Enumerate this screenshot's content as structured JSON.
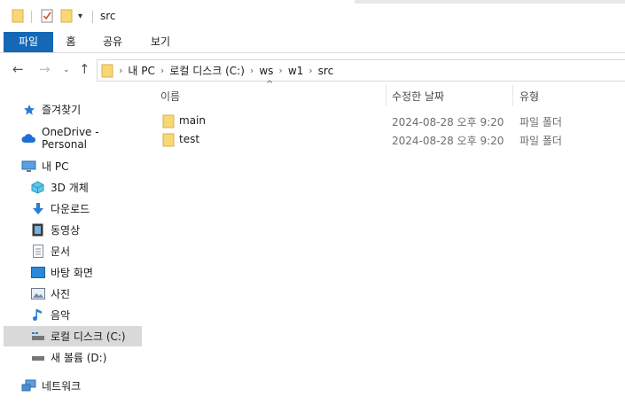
{
  "window": {
    "title": "src"
  },
  "ribbon": {
    "tabs": [
      {
        "label": "파일",
        "active": true
      },
      {
        "label": "홈",
        "active": false
      },
      {
        "label": "공유",
        "active": false
      },
      {
        "label": "보기",
        "active": false
      }
    ]
  },
  "address": {
    "crumbs": [
      "내 PC",
      "로컬 디스크 (C:)",
      "ws",
      "w1",
      "src"
    ]
  },
  "sidebar": {
    "items": [
      {
        "label": "즐겨찾기",
        "icon": "star-icon"
      },
      {
        "label": "OneDrive - Personal",
        "icon": "cloud-icon"
      },
      {
        "label": "내 PC",
        "icon": "monitor-icon"
      },
      {
        "label": "3D 개체",
        "icon": "cube-icon"
      },
      {
        "label": "다운로드",
        "icon": "download-arrow-icon"
      },
      {
        "label": "동영상",
        "icon": "film-icon"
      },
      {
        "label": "문서",
        "icon": "document-icon"
      },
      {
        "label": "바탕 화면",
        "icon": "desktop-icon"
      },
      {
        "label": "사진",
        "icon": "picture-icon"
      },
      {
        "label": "음악",
        "icon": "music-note-icon"
      },
      {
        "label": "로컬 디스크 (C:)",
        "icon": "drive-icon",
        "selected": true
      },
      {
        "label": "새 볼륨 (D:)",
        "icon": "drive-icon"
      },
      {
        "label": "네트워크",
        "icon": "network-icon"
      }
    ]
  },
  "list": {
    "columns": {
      "name": "이름",
      "date": "수정한 날짜",
      "type": "유형"
    },
    "rows": [
      {
        "name": "main",
        "date": "2024-08-28 오후 9:20",
        "type": "파일 폴더"
      },
      {
        "name": "test",
        "date": "2024-08-28 오후 9:20",
        "type": "파일 폴더"
      }
    ]
  },
  "colors": {
    "accent": "#1568b6",
    "folder": "#f8d775",
    "selected": "#d9d9d9"
  }
}
